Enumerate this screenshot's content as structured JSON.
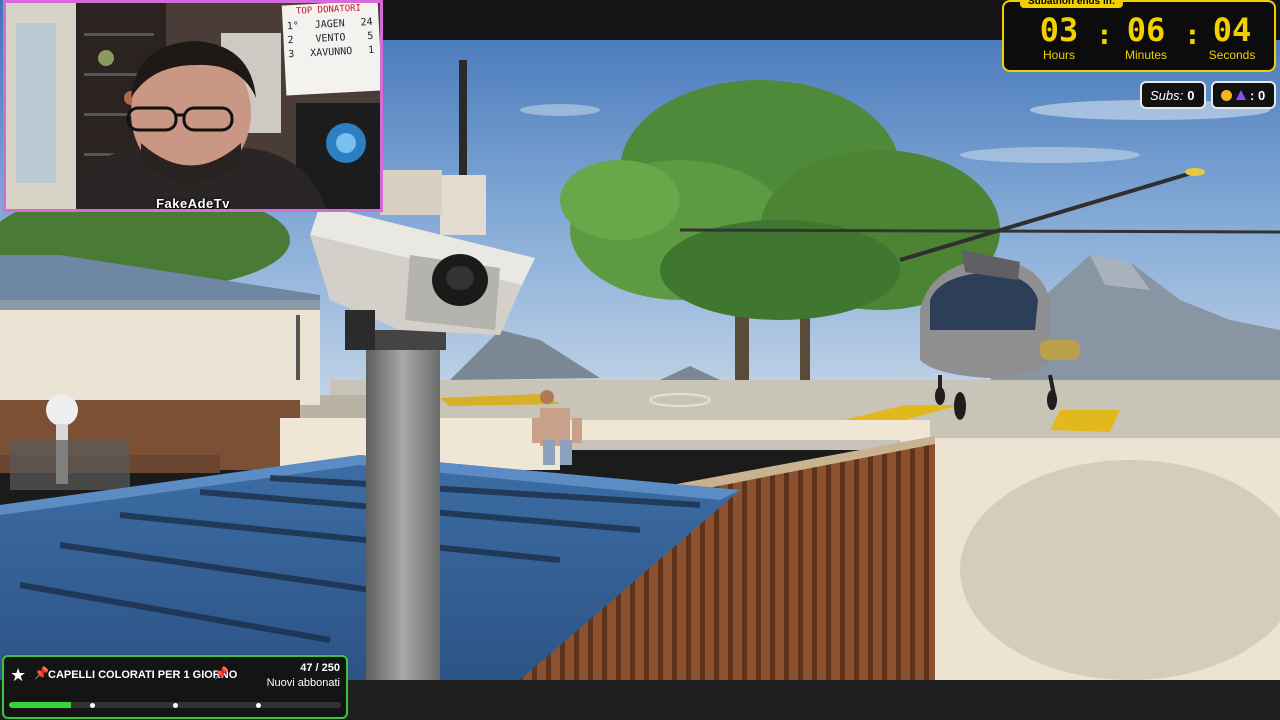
{
  "stream": {
    "streamer_name": "FakeAdeTv",
    "donor_board": {
      "title": "TOP DONATORI",
      "entries": [
        {
          "rank": "1°",
          "name": "JAGEN",
          "amount": "24"
        },
        {
          "rank": "2",
          "name": "VENTO",
          "amount": "5"
        },
        {
          "rank": "3",
          "name": "XAVUNNO",
          "amount": "1"
        }
      ]
    }
  },
  "subathon": {
    "title": "Subathon ends in:",
    "hours": "03",
    "minutes": "06",
    "seconds": "04",
    "hours_label": "Hours",
    "minutes_label": "Minutes",
    "seconds_label": "Seconds",
    "separator": ":"
  },
  "counters": {
    "subs_label": "Subs:",
    "subs_value": "0",
    "donations_value": ": 0",
    "coin_icon": "coin-icon",
    "gem_icon": "gem-icon"
  },
  "goal": {
    "star_icon": "star-icon",
    "pin_icon": "pin-icon",
    "title": "CAPELLI COLORATI PER 1 GIORNO",
    "count": "47 / 250",
    "subtitle": "Nuovi abbonati",
    "progress_fraction": 0.188,
    "milestones": [
      0.25,
      0.5,
      0.75
    ],
    "accent_color": "#33d633"
  },
  "colors": {
    "timer_accent": "#f2d000",
    "cam_border": "#d46bd8"
  }
}
